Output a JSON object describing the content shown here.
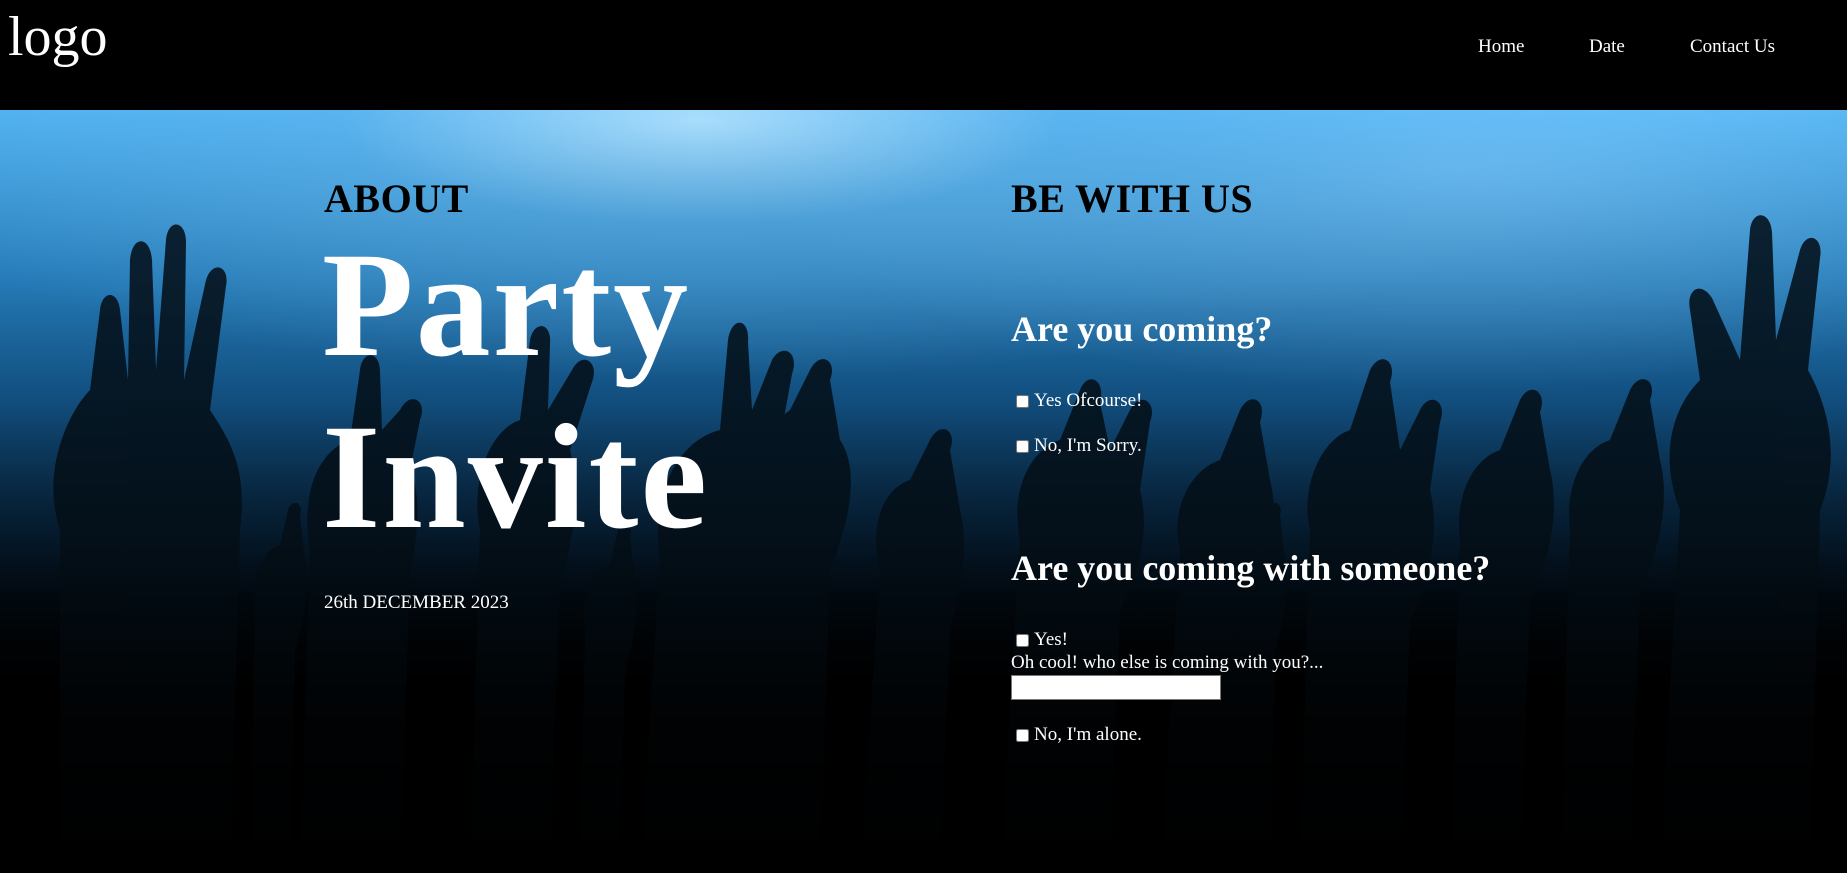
{
  "header": {
    "logo": "logo",
    "nav": [
      {
        "label": "Home"
      },
      {
        "label": "Date"
      },
      {
        "label": "Contact Us"
      }
    ]
  },
  "about": {
    "heading": "ABOUT",
    "title_line1": "Party",
    "title_line2": "Invite",
    "date": "26th DECEMBER 2023"
  },
  "rsvp": {
    "heading": "BE WITH US",
    "question1": "Are you coming?",
    "q1_options": [
      {
        "label": "Yes Ofcourse!",
        "checked": false
      },
      {
        "label": "No, I'm Sorry.",
        "checked": false
      }
    ],
    "question2": "Are you coming with someone?",
    "q2_yes": {
      "label": "Yes!",
      "checked": false
    },
    "companion_prompt": "Oh cool! who else is coming with you?...",
    "companion_input_value": "",
    "q2_no": {
      "label": "No, I'm alone.",
      "checked": false
    }
  },
  "colors": {
    "background": "#000000",
    "sky_light": "#aee0ff",
    "sky_mid": "#2b8fd6",
    "text": "#ffffff",
    "heading_dark": "#000000"
  }
}
